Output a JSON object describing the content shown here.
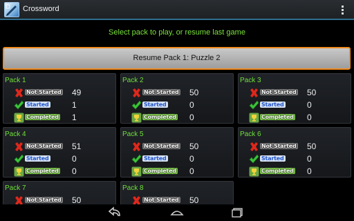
{
  "app": {
    "title": "Crossword",
    "icon": "crossword-pen-icon"
  },
  "instruction": "Select pack to play, or resume last game",
  "resume_label": "Resume Pack 1: Puzzle 2",
  "status_labels": {
    "not_started": "Not Started",
    "started": "Started",
    "completed": "Completed"
  },
  "colors": {
    "accent": "#f08a1c",
    "title_green": "#7be33b",
    "actionbar_line": "#2f6f8f"
  },
  "packs": [
    {
      "name": "Pack 1",
      "not_started": "49",
      "started": "1",
      "completed": "1"
    },
    {
      "name": "Pack 2",
      "not_started": "50",
      "started": "0",
      "completed": "0"
    },
    {
      "name": "Pack 3",
      "not_started": "50",
      "started": "0",
      "completed": "0"
    },
    {
      "name": "Pack 4",
      "not_started": "51",
      "started": "0",
      "completed": "0"
    },
    {
      "name": "Pack 5",
      "not_started": "50",
      "started": "0",
      "completed": "0"
    },
    {
      "name": "Pack 6",
      "not_started": "50",
      "started": "0",
      "completed": "0"
    },
    {
      "name": "Pack 7",
      "not_started": "50"
    },
    {
      "name": "Pack 8",
      "not_started": "50"
    }
  ],
  "navbar": {
    "icons": [
      "back-icon",
      "home-icon",
      "recent-apps-icon"
    ]
  }
}
